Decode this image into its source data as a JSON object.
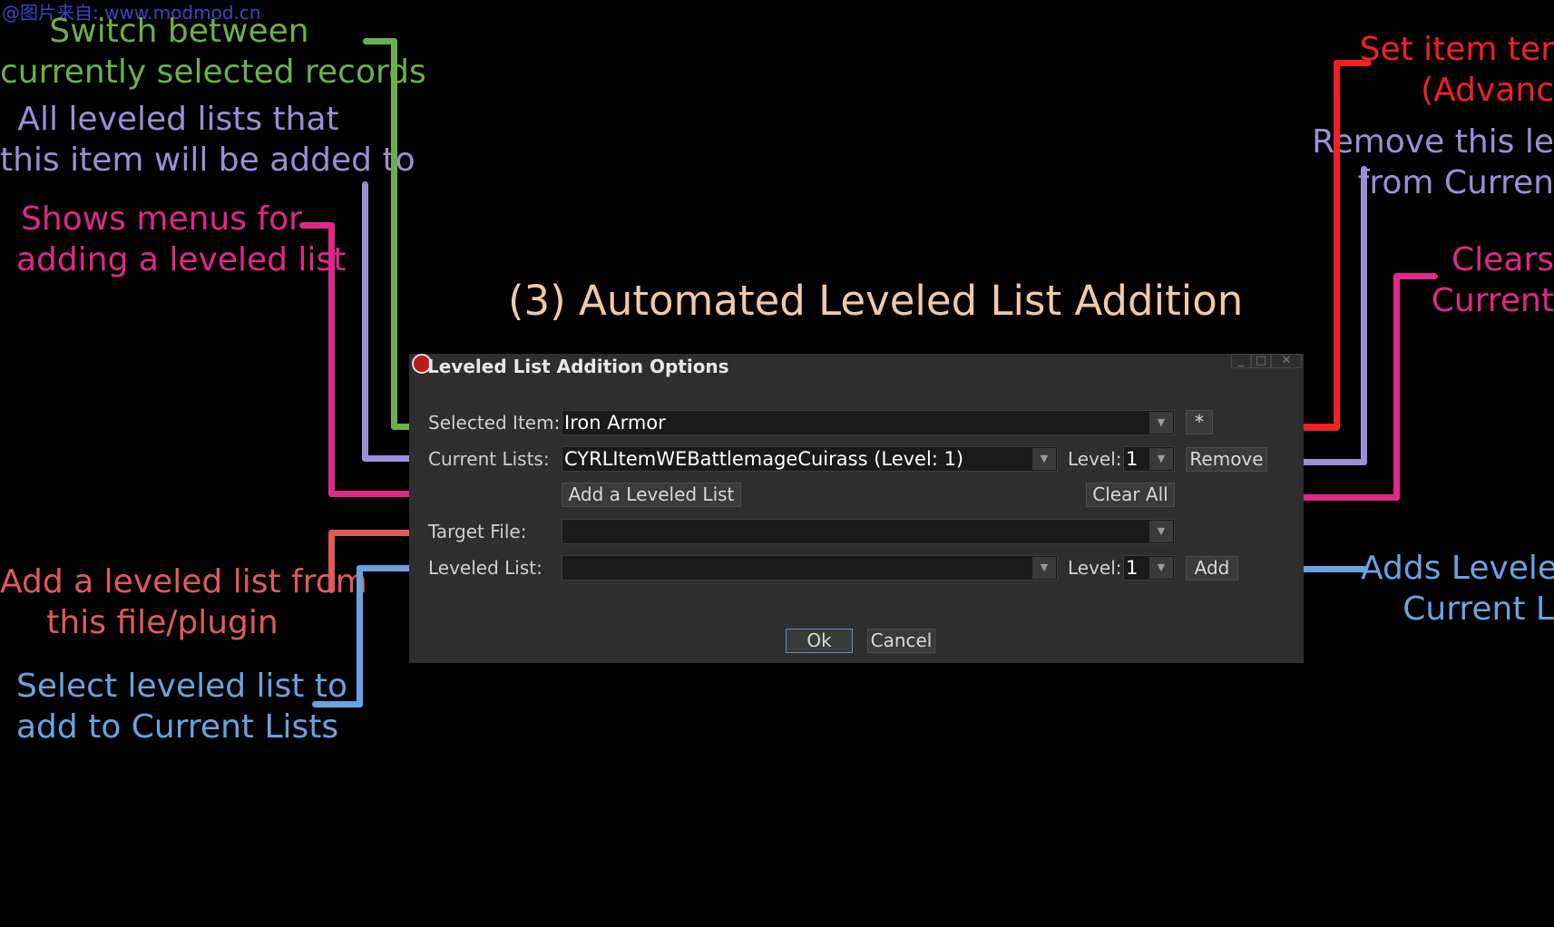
{
  "watermark": "@图片来自: www.modmod.cn",
  "heading": "(3) Automated Leveled List Addition",
  "annotations": {
    "switch_records": {
      "line1": "Switch between",
      "line2": "currently selected records",
      "color": "#6ab04c"
    },
    "all_lists": {
      "line1": "All leveled lists that",
      "line2": "this item will be added to",
      "color": "#9a8fd6"
    },
    "shows_menus": {
      "line1": "Shows menus for",
      "line2": "adding a leveled list",
      "color": "#e0288a"
    },
    "add_from_file": {
      "line1": "Add a leveled list from",
      "line2": "this file/plugin",
      "color": "#e05a5a"
    },
    "select_list": {
      "line1": "Select leveled list to",
      "line2": "add to Current Lists",
      "color": "#6aa3e0"
    },
    "set_template": {
      "line1": "Set item ter",
      "line2": "(Advanc",
      "color": "#ee2222"
    },
    "remove_list": {
      "line1": "Remove this le",
      "line2": "from Curren",
      "color": "#9a8fd6"
    },
    "clears": {
      "line1": "Clears",
      "line2": "Current",
      "color": "#e0288a"
    },
    "adds_leveled": {
      "line1": "Adds Levele",
      "line2": "Current L",
      "color": "#6aa3e0"
    }
  },
  "dialog": {
    "title": "Leveled List Addition Options",
    "icon": "app-icon",
    "window_controls": {
      "minimize": "_",
      "maximize": "□",
      "close": "✕"
    },
    "selected_item": {
      "label": "Selected Item:",
      "value": "Iron Armor",
      "star_button": "*"
    },
    "current_lists": {
      "label": "Current Lists:",
      "value": "CYRLItemWEBattlemageCuirass (Level: 1)",
      "level_label": "Level:",
      "level_value": "1",
      "remove_button": "Remove"
    },
    "add_leveled_list_button": "Add a Leveled List",
    "clear_all_button": "Clear All",
    "target_file": {
      "label": "Target File:",
      "value": ""
    },
    "leveled_list": {
      "label": "Leveled List:",
      "value": "",
      "level_label": "Level:",
      "level_value": "1",
      "add_button": "Add"
    },
    "ok_button": "Ok",
    "cancel_button": "Cancel",
    "dropdown_arrow": "▼"
  }
}
